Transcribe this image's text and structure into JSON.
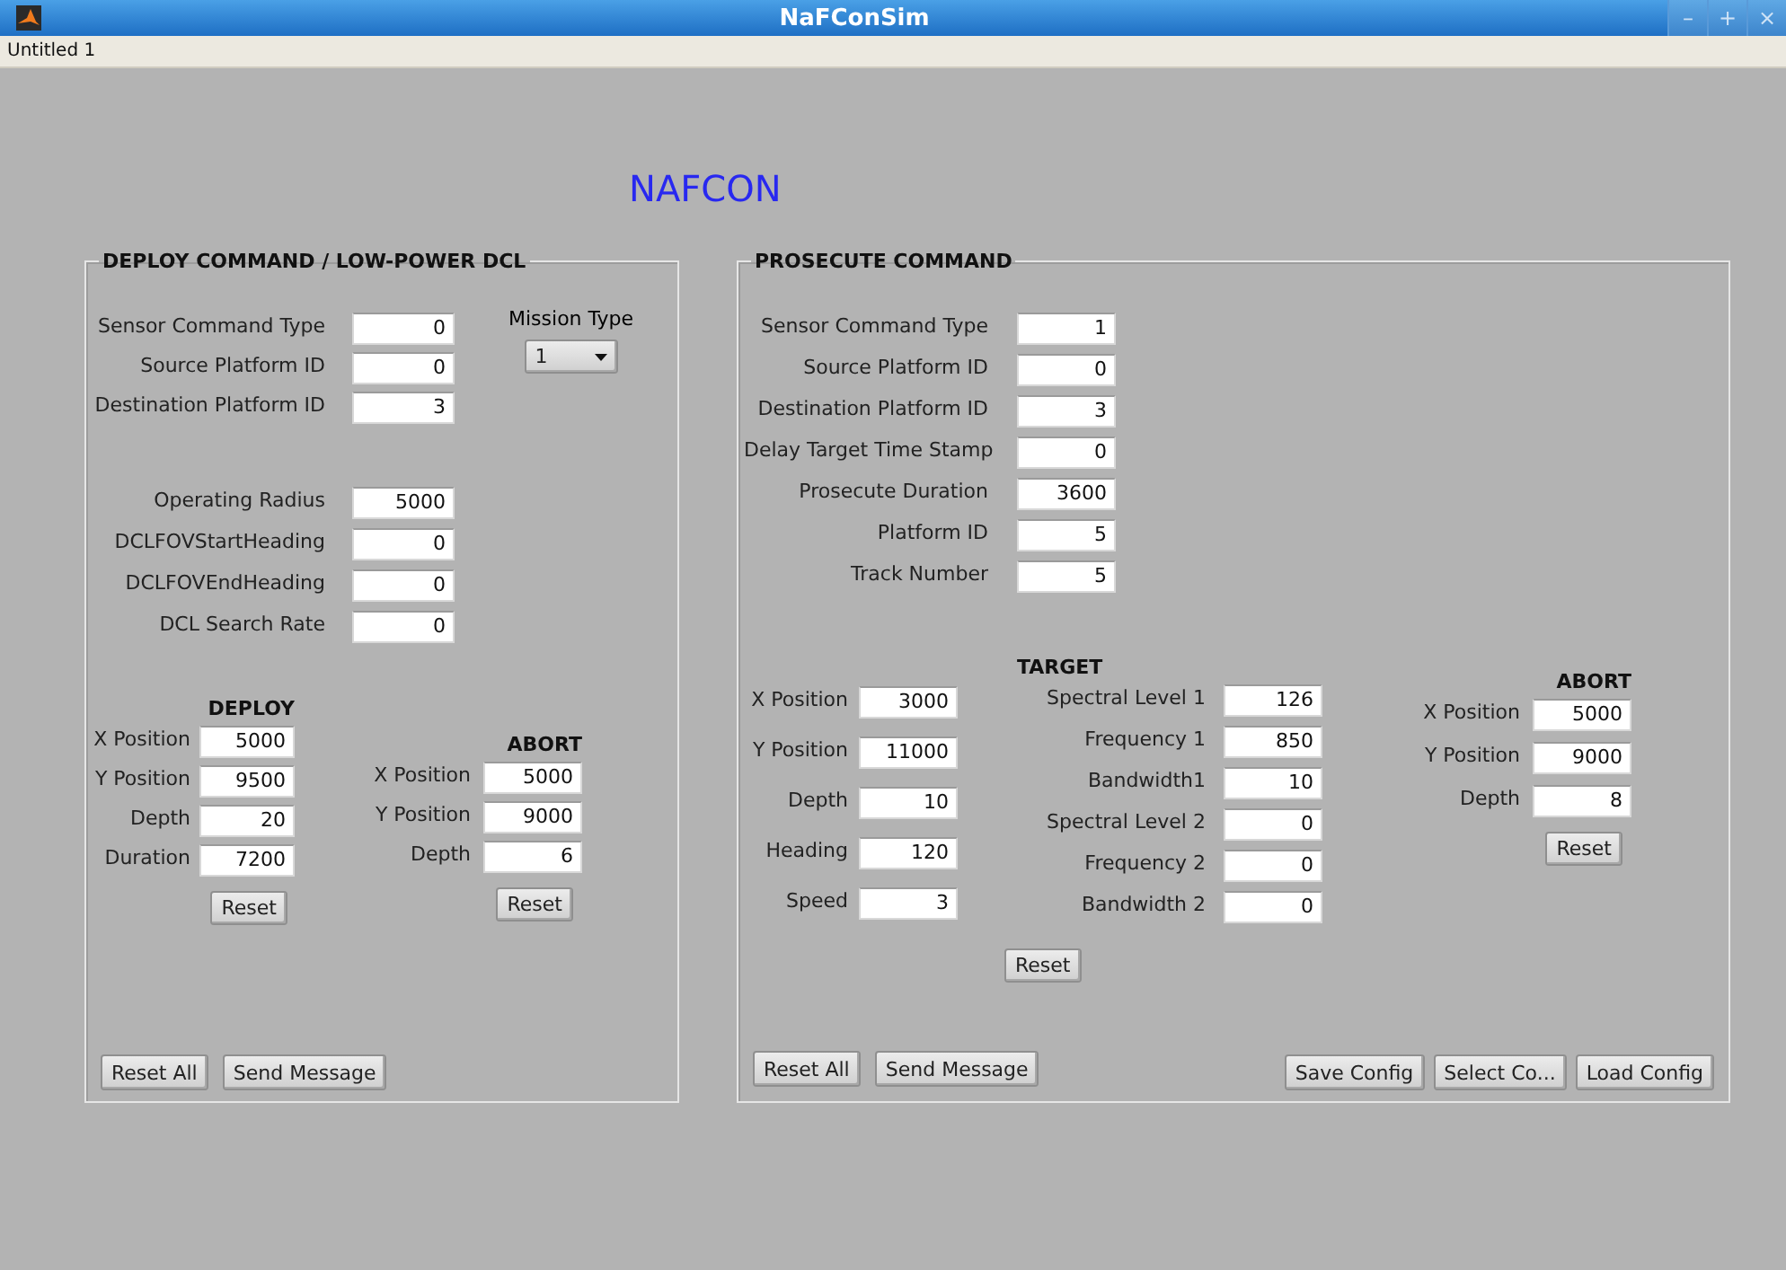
{
  "window": {
    "title": "NaFConSim",
    "controls": [
      "–",
      "+",
      "×"
    ]
  },
  "menu_bar": [
    {
      "label": "Untitled 1"
    }
  ],
  "heading": "NAFCON",
  "deploy_panel": {
    "title": "DEPLOY COMMAND / LOW-POWER DCL",
    "fields": [
      {
        "label": "Sensor Command Type",
        "value": "0"
      },
      {
        "label": "Source Platform ID",
        "value": "0"
      },
      {
        "label": "Destination Platform ID",
        "value": "3"
      }
    ],
    "mission_type": {
      "label": "Mission Type",
      "value": "1"
    },
    "dcl_fields": [
      {
        "label": "Operating Radius",
        "value": "5000"
      },
      {
        "label": "DCLFOVStartHeading",
        "value": "0"
      },
      {
        "label": "DCLFOVEndHeading",
        "value": "0"
      },
      {
        "label": "DCL Search Rate",
        "value": "0"
      }
    ],
    "deploy": {
      "title": "DEPLOY",
      "fields": [
        {
          "label": "X Position",
          "value": "5000"
        },
        {
          "label": "Y Position",
          "value": "9500"
        },
        {
          "label": "Depth",
          "value": "20"
        },
        {
          "label": "Duration",
          "value": "7200"
        }
      ],
      "button": "Reset"
    },
    "abort": {
      "title": "ABORT",
      "fields": [
        {
          "label": "X Position",
          "value": "5000"
        },
        {
          "label": "Y Position",
          "value": "9000"
        },
        {
          "label": "Depth",
          "value": "6"
        }
      ],
      "button": "Reset"
    },
    "buttons": [
      "Reset All",
      "Send Message"
    ]
  },
  "prosecute_panel": {
    "title": "PROSECUTE COMMAND",
    "fields": [
      {
        "label": "Sensor Command Type",
        "value": "1"
      },
      {
        "label": "Source Platform ID",
        "value": "0"
      },
      {
        "label": "Destination Platform ID",
        "value": "3"
      },
      {
        "label": "Delay Target Time Stamp",
        "value": "0"
      },
      {
        "label": "Prosecute Duration",
        "value": "3600"
      },
      {
        "label": "Platform ID",
        "value": "5"
      },
      {
        "label": "Track Number",
        "value": "5"
      }
    ],
    "motion_fields": [
      {
        "label": "X Position",
        "value": "3000"
      },
      {
        "label": "Y Position",
        "value": "11000"
      },
      {
        "label": "Depth",
        "value": "10"
      },
      {
        "label": "Heading",
        "value": "120"
      },
      {
        "label": "Speed",
        "value": "3"
      }
    ],
    "target": {
      "title": "TARGET",
      "fields": [
        {
          "label": "Spectral Level 1",
          "value": "126"
        },
        {
          "label": "Frequency 1",
          "value": "850"
        },
        {
          "label": "Bandwidth1",
          "value": "10"
        },
        {
          "label": "Spectral Level 2",
          "value": "0"
        },
        {
          "label": "Frequency 2",
          "value": "0"
        },
        {
          "label": "Bandwidth 2",
          "value": "0"
        }
      ],
      "button": "Reset"
    },
    "abort": {
      "title": "ABORT",
      "fields": [
        {
          "label": "X Position",
          "value": "5000"
        },
        {
          "label": "Y Position",
          "value": "9000"
        },
        {
          "label": "Depth",
          "value": "8"
        }
      ],
      "button": "Reset"
    },
    "buttons": [
      "Reset All",
      "Send Message"
    ],
    "config_buttons": [
      "Save Config",
      "Select Co...",
      "Load Config"
    ]
  }
}
